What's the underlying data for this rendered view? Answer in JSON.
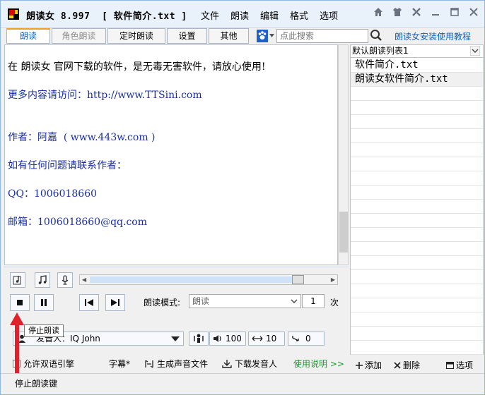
{
  "titlebar": {
    "app_name": "朗读女 8.997",
    "file_name": "[ 软件简介.txt ]",
    "menu": [
      "文件",
      "朗读",
      "编辑",
      "格式",
      "选项"
    ]
  },
  "tabs": [
    {
      "label": "朗读",
      "state": "active"
    },
    {
      "label": "角色朗读",
      "state": "disabled"
    },
    {
      "label": "定时朗读",
      "state": "normal"
    },
    {
      "label": "设置",
      "state": "normal"
    },
    {
      "label": "其他",
      "state": "normal"
    }
  ],
  "search": {
    "placeholder": "点此搜索"
  },
  "help_link": "朗读女安装使用教程",
  "document_lines": [
    {
      "text": "在 朗读女 官网下载的软件，是无毒无害软件，请放心使用!",
      "style": "dark"
    },
    {
      "text": "更多内容请访问：http://www.TTSini.com",
      "style": "blue"
    },
    {
      "text": "作者：阿嘉  ( www.443w.com )",
      "style": "blue"
    },
    {
      "text": "如有任何问题请联系作者：",
      "style": "blue"
    },
    {
      "text": "QQ：1006018660",
      "style": "blue"
    },
    {
      "text": "邮箱：1006018660@qq.com",
      "style": "blue"
    }
  ],
  "playlist": {
    "selected_list": "默认朗读列表1",
    "items": [
      "软件简介.txt",
      "朗读女软件简介.txt"
    ],
    "add_label": "添加",
    "delete_label": "删除",
    "options_label": "选项"
  },
  "controls": {
    "mode_label": "朗读模式:",
    "mode_value": "朗读",
    "repeat_count": "1",
    "repeat_unit": "次",
    "voice_prefix": "发音人：",
    "voice_name": "IQ John",
    "volume": "100",
    "rate": "10",
    "pitch": "0",
    "tooltip": "停止朗读"
  },
  "bottom_options": {
    "bilingual": "允许双语引擎",
    "subtitle": "字幕*",
    "generate_audio": "生成声音文件",
    "download_voice": "下载发音人",
    "instructions": "使用说明 >>"
  },
  "status": {
    "text": "停止朗读键"
  },
  "colors": {
    "accent_blue": "#0b62c4",
    "text_blue": "#1a2fa0",
    "arrow_red": "#e0202a"
  }
}
